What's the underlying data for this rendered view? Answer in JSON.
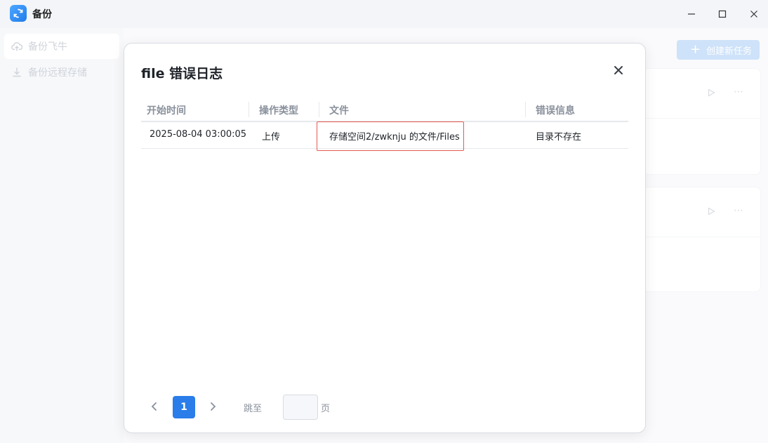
{
  "app": {
    "title": "备份",
    "icon": "sync-icon",
    "accent": "#2b7de9"
  },
  "sidebar": {
    "items": [
      {
        "label": "备份飞牛",
        "icon": "cloud-upload-icon",
        "active": true
      },
      {
        "label": "备份远程存储",
        "icon": "download-icon",
        "active": false
      }
    ]
  },
  "main": {
    "create_button": {
      "icon": "plus",
      "label": "创建新任务"
    }
  },
  "modal": {
    "title": "file 错误日志",
    "columns": [
      "开始时间",
      "操作类型",
      "文件",
      "错误信息"
    ],
    "rows": [
      {
        "start_time": "2025-08-04 03:00:05",
        "operation": "上传",
        "file": "存储空间2/zwknju 的文件/Files",
        "error": "目录不存在"
      }
    ],
    "highlight_color": "#e65a52",
    "pagination": {
      "current_page": "1",
      "jump_label": "跳至",
      "page_suffix": "页",
      "jump_value": ""
    }
  }
}
